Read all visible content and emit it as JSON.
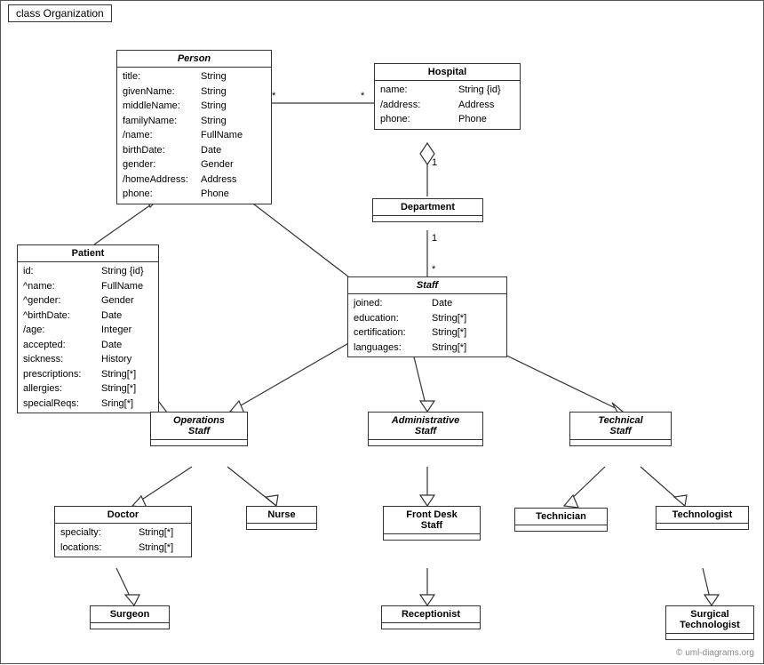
{
  "title": "class Organization",
  "classes": {
    "person": {
      "name": "Person",
      "italic": true,
      "attrs": [
        {
          "name": "title:",
          "type": "String"
        },
        {
          "name": "givenName:",
          "type": "String"
        },
        {
          "name": "middleName:",
          "type": "String"
        },
        {
          "name": "familyName:",
          "type": "String"
        },
        {
          "name": "/name:",
          "type": "FullName"
        },
        {
          "name": "birthDate:",
          "type": "Date"
        },
        {
          "name": "gender:",
          "type": "Gender"
        },
        {
          "name": "/homeAddress:",
          "type": "Address"
        },
        {
          "name": "phone:",
          "type": "Phone"
        }
      ]
    },
    "hospital": {
      "name": "Hospital",
      "italic": false,
      "attrs": [
        {
          "name": "name:",
          "type": "String {id}"
        },
        {
          "name": "/address:",
          "type": "Address"
        },
        {
          "name": "phone:",
          "type": "Phone"
        }
      ]
    },
    "patient": {
      "name": "Patient",
      "italic": false,
      "attrs": [
        {
          "name": "id:",
          "type": "String {id}"
        },
        {
          "name": "^name:",
          "type": "FullName"
        },
        {
          "name": "^gender:",
          "type": "Gender"
        },
        {
          "name": "^birthDate:",
          "type": "Date"
        },
        {
          "name": "/age:",
          "type": "Integer"
        },
        {
          "name": "accepted:",
          "type": "Date"
        },
        {
          "name": "sickness:",
          "type": "History"
        },
        {
          "name": "prescriptions:",
          "type": "String[*]"
        },
        {
          "name": "allergies:",
          "type": "String[*]"
        },
        {
          "name": "specialReqs:",
          "type": "Sring[*]"
        }
      ]
    },
    "department": {
      "name": "Department",
      "italic": false,
      "attrs": []
    },
    "staff": {
      "name": "Staff",
      "italic": true,
      "attrs": [
        {
          "name": "joined:",
          "type": "Date"
        },
        {
          "name": "education:",
          "type": "String[*]"
        },
        {
          "name": "certification:",
          "type": "String[*]"
        },
        {
          "name": "languages:",
          "type": "String[*]"
        }
      ]
    },
    "ops_staff": {
      "name": "Operations Staff",
      "italic": true,
      "attrs": []
    },
    "admin_staff": {
      "name": "Administrative Staff",
      "italic": true,
      "attrs": []
    },
    "tech_staff": {
      "name": "Technical Staff",
      "italic": true,
      "attrs": []
    },
    "doctor": {
      "name": "Doctor",
      "italic": false,
      "attrs": [
        {
          "name": "specialty:",
          "type": "String[*]"
        },
        {
          "name": "locations:",
          "type": "String[*]"
        }
      ]
    },
    "nurse": {
      "name": "Nurse",
      "italic": false,
      "attrs": []
    },
    "front_desk": {
      "name": "Front Desk Staff",
      "italic": false,
      "attrs": []
    },
    "technician": {
      "name": "Technician",
      "italic": false,
      "attrs": []
    },
    "technologist": {
      "name": "Technologist",
      "italic": false,
      "attrs": []
    },
    "surgeon": {
      "name": "Surgeon",
      "italic": false,
      "attrs": []
    },
    "receptionist": {
      "name": "Receptionist",
      "italic": false,
      "attrs": []
    },
    "surgical_tech": {
      "name": "Surgical Technologist",
      "italic": false,
      "attrs": []
    }
  },
  "watermark": "© uml-diagrams.org"
}
